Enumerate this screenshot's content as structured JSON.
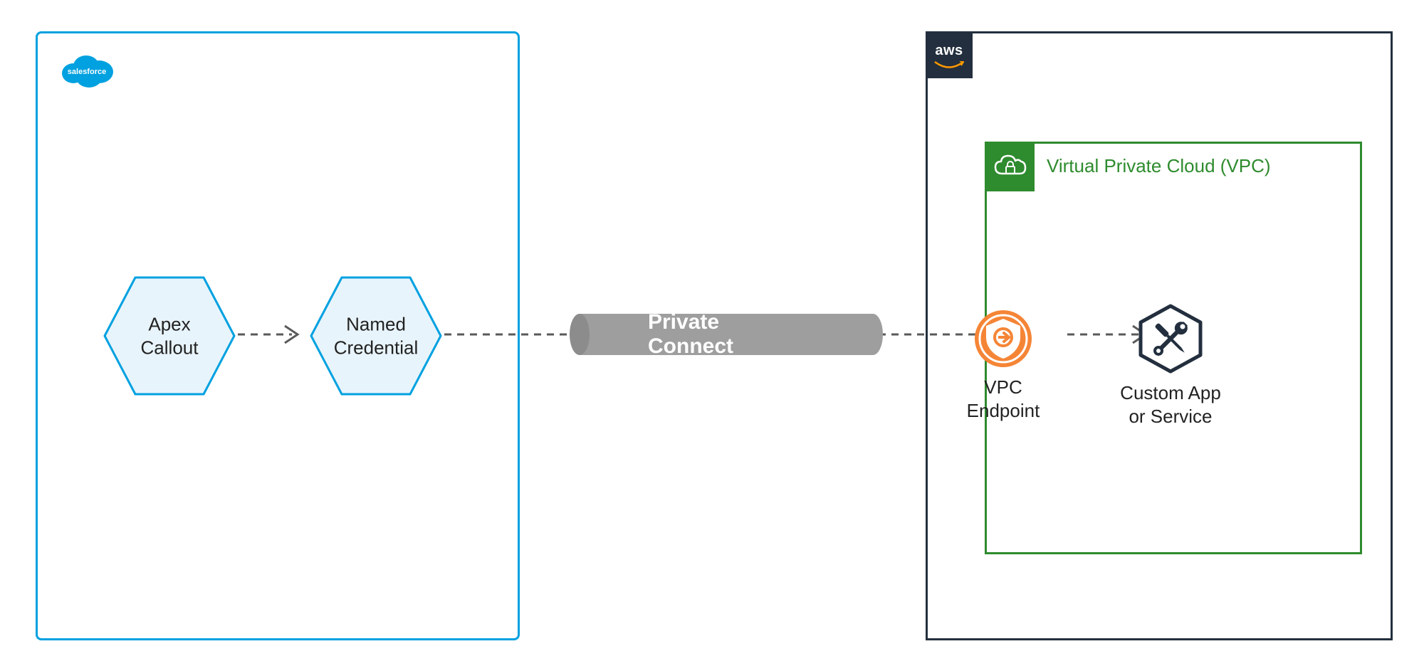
{
  "salesforce": {
    "logo_text": "salesforce",
    "nodes": {
      "apex": {
        "line1": "Apex",
        "line2": "Callout"
      },
      "named_cred": {
        "line1": "Named",
        "line2": "Credential"
      }
    }
  },
  "pipe": {
    "label": "Private Connect"
  },
  "aws": {
    "badge_text": "aws",
    "vpc": {
      "title": "Virtual Private Cloud (VPC)",
      "endpoint": {
        "line1": "VPC",
        "line2": "Endpoint"
      },
      "custom": {
        "line1": "Custom App",
        "line2": "or Service"
      }
    }
  },
  "colors": {
    "salesforce_blue": "#00A1E0",
    "hex_fill": "#E8F4FB",
    "pipe_gray": "#9E9E9E",
    "pipe_gray_dark": "#8C8C8C",
    "aws_navy": "#232F3E",
    "vpc_green": "#2E8B2E",
    "endpoint_orange": "#F58536"
  }
}
